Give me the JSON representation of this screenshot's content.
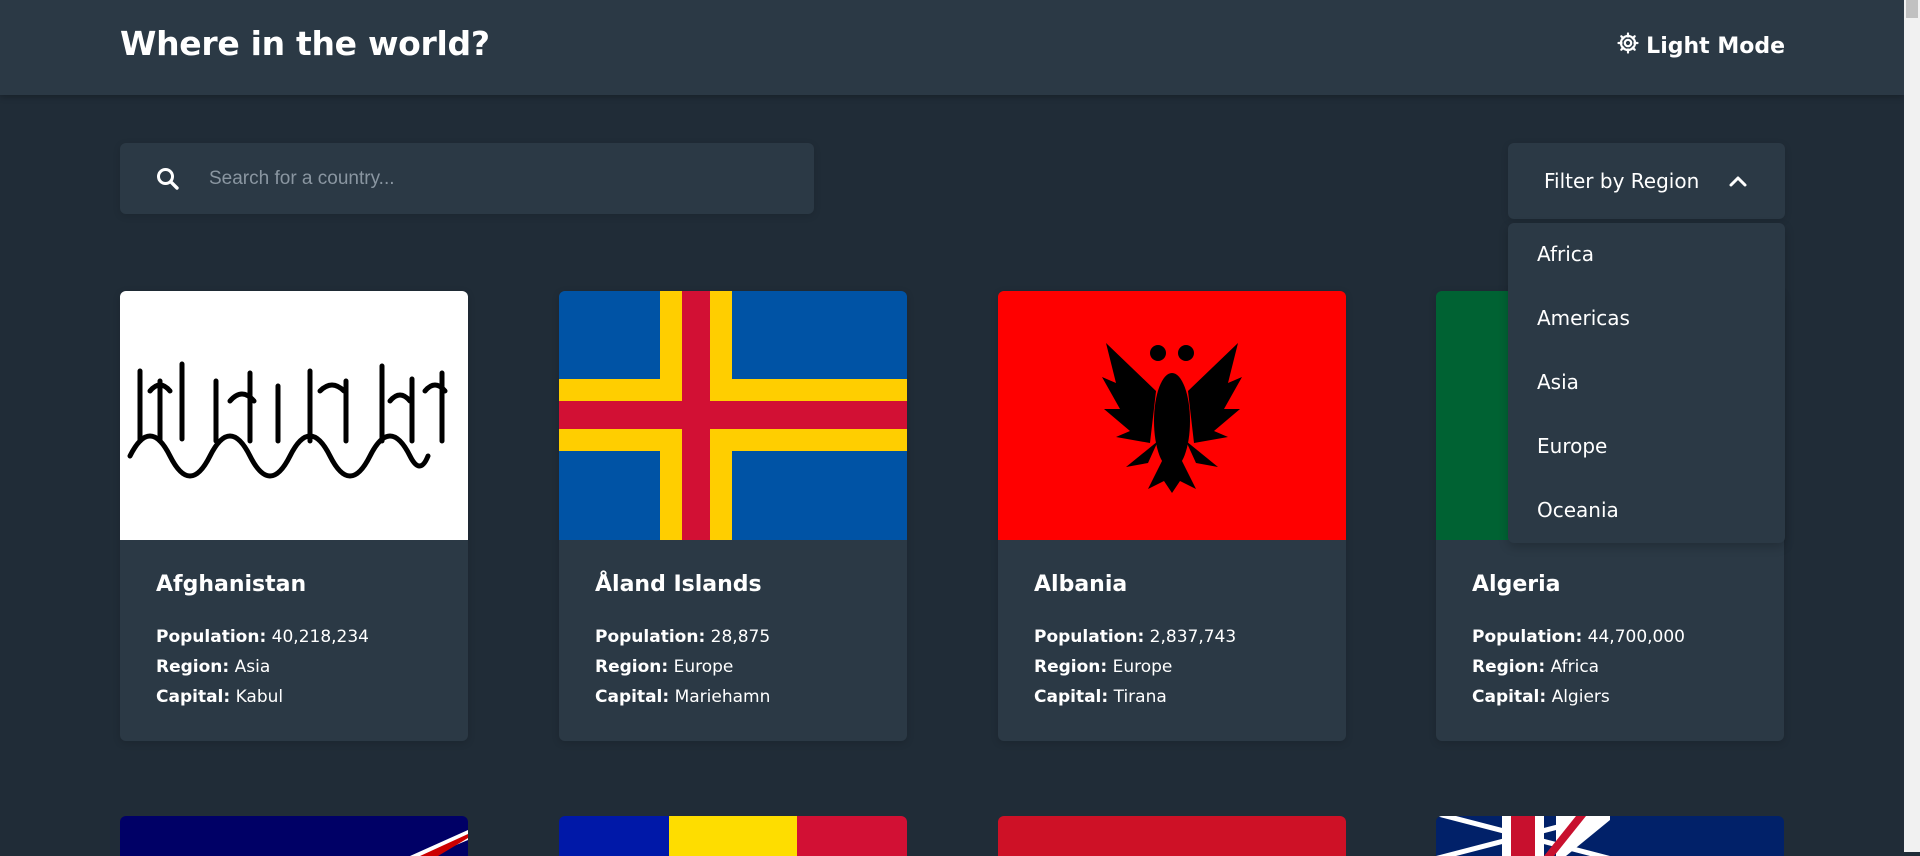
{
  "header": {
    "title": "Where in the world?",
    "mode_toggle_label": "Light Mode",
    "mode_icon": "gear-icon"
  },
  "search": {
    "placeholder": "Search for a country...",
    "value": "",
    "icon": "search-icon"
  },
  "filter": {
    "label": "Filter by Region",
    "icon": "chevron-up-icon",
    "options": [
      "Africa",
      "Americas",
      "Asia",
      "Europe",
      "Oceania"
    ]
  },
  "labels": {
    "population": "Population:",
    "region": "Region:",
    "capital": "Capital:"
  },
  "countries": [
    {
      "name": "Afghanistan",
      "population": "40,218,234",
      "region": "Asia",
      "capital": "Kabul"
    },
    {
      "name": "Åland Islands",
      "population": "28,875",
      "region": "Europe",
      "capital": "Mariehamn"
    },
    {
      "name": "Albania",
      "population": "2,837,743",
      "region": "Europe",
      "capital": "Tirana"
    },
    {
      "name": "Algeria",
      "population": "44,700,000",
      "region": "Africa",
      "capital": "Algiers"
    }
  ],
  "colors": {
    "background": "#202c37",
    "element": "#2b3945",
    "text": "#ffffff"
  }
}
